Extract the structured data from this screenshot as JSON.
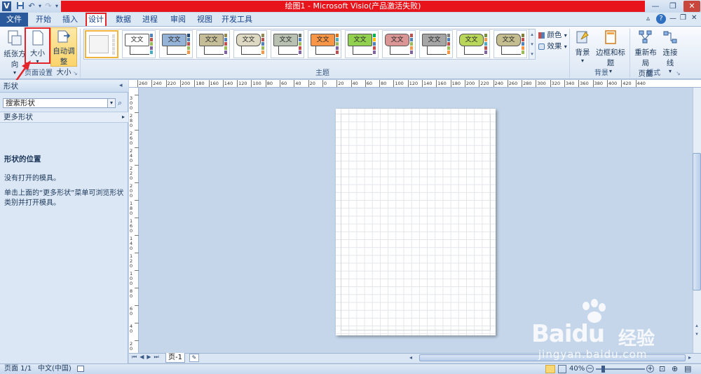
{
  "window": {
    "title": "绘图1 - Microsoft Visio(产品激活失败)",
    "app_icon": "V"
  },
  "tabs": [
    "文件",
    "开始",
    "插入",
    "设计",
    "数据",
    "进程",
    "审阅",
    "视图",
    "开发工具"
  ],
  "ribbon": {
    "page_setup": {
      "orientation_label": "纸张方向",
      "size_label": "大小",
      "autosize_label_1": "自动调整",
      "autosize_label_2": "大小",
      "group_label": "页面设置"
    },
    "themes": {
      "group_label": "主题",
      "swatch_text": "文文",
      "colors_label": "颜色",
      "effects_label": "效果"
    },
    "background": {
      "background_label": "背景",
      "borders_label": "边框和标题",
      "group_label": "背景"
    },
    "layout": {
      "relayout_label_1": "重新布局",
      "relayout_label_2": "页面",
      "connectors_label": "连接线",
      "group_label": "版式"
    }
  },
  "shapes_pane": {
    "title": "形状",
    "search_placeholder": "搜索形状",
    "more_shapes": "更多形状",
    "heading": "形状的位置",
    "no_stencils": "没有打开的模具。",
    "hint": "单击上面的“更多形状”菜单可浏览形状类别并打开模具。"
  },
  "ruler_h_labels": [
    "260",
    "240",
    "220",
    "200",
    "180",
    "160",
    "140",
    "120",
    "100",
    "80",
    "60",
    "40",
    "20",
    "0",
    "20",
    "40",
    "60",
    "80",
    "100",
    "120",
    "140",
    "160",
    "180",
    "200",
    "220",
    "240",
    "260",
    "280",
    "300",
    "320",
    "340",
    "360",
    "380",
    "400",
    "420",
    "440"
  ],
  "ruler_v_labels": [
    "300",
    "280",
    "260",
    "240",
    "220",
    "200",
    "180",
    "160",
    "140",
    "120",
    "100",
    "80",
    "60",
    "40",
    "20"
  ],
  "page_tab": "页-1",
  "status": {
    "page": "页面 1/1",
    "language": "中文(中国)",
    "zoom": "40%"
  },
  "watermark": {
    "brand": "Bai",
    "brand2": "du",
    "cn": "经验",
    "url": "jingyan.baidu.com"
  },
  "colors": {
    "highlight": "#e3242b",
    "title_red": "#e8141c",
    "file_tab": "#2a5a9b"
  }
}
